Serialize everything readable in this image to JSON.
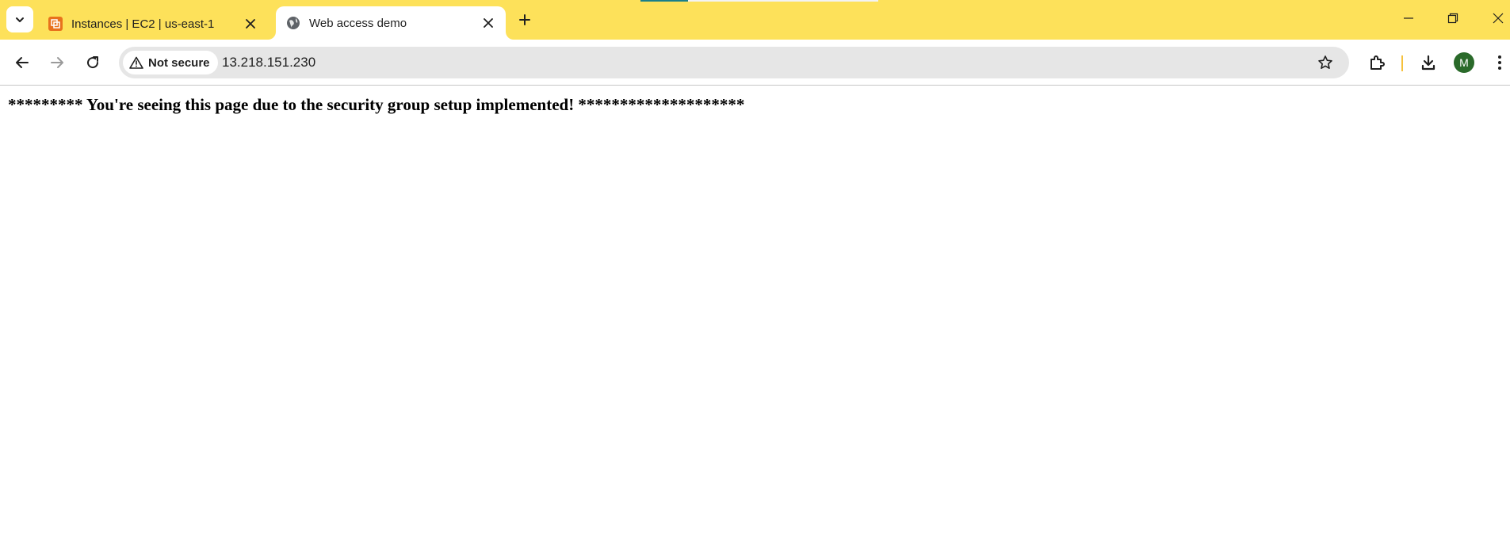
{
  "browser": {
    "tabs": [
      {
        "title": "Instances | EC2 | us-east-1",
        "active": false,
        "favicon": "aws-ec2-icon"
      },
      {
        "title": "Web access demo",
        "active": true,
        "favicon": "globe-icon"
      }
    ],
    "address_bar": {
      "security_label": "Not secure",
      "url": "13.218.151.230"
    },
    "profile_initial": "M",
    "colors": {
      "tab_strip": "#fde15a",
      "profile_avatar": "#2a6a2a",
      "ec2_favicon": "#e8721c"
    }
  },
  "page": {
    "headline": "********* You're seeing this page due to the security group setup implemented! ********************"
  }
}
